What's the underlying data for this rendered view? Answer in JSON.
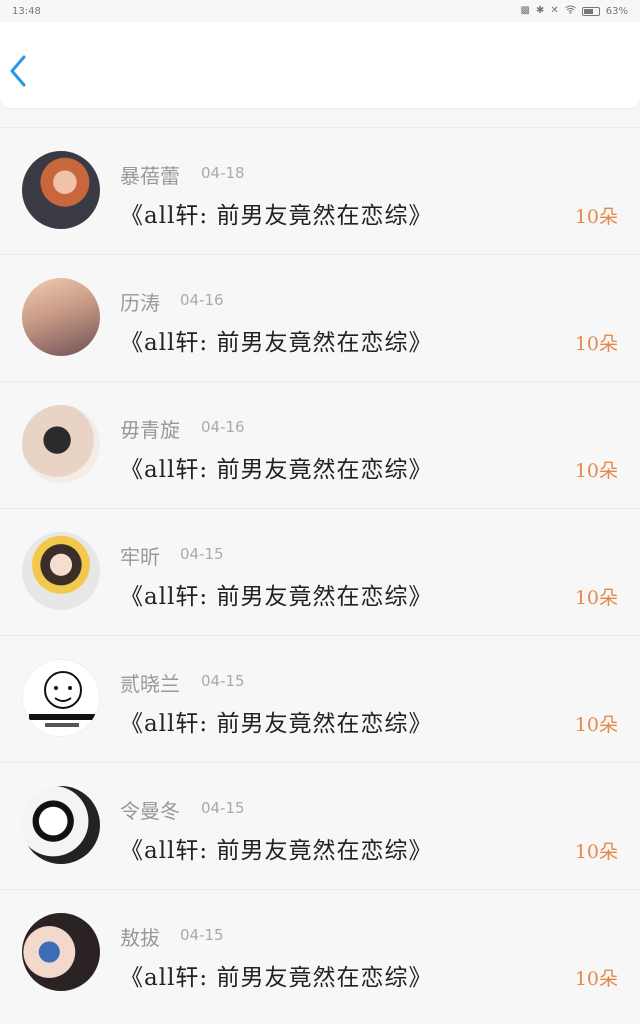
{
  "status_bar": {
    "time": "13:48",
    "battery": "63%",
    "battery_level": 0.63,
    "icons": [
      "nfc-icon",
      "bluetooth-icon",
      "mute-icon",
      "wifi-icon",
      "battery-icon"
    ]
  },
  "header": {
    "back_icon": "chevron-left-icon",
    "accent": "#2a97e6"
  },
  "list": [
    {
      "name": "暴蓓蕾",
      "date": "04-18",
      "title": "《all轩:  前男友竟然在恋综》",
      "amount": "10朵"
    },
    {
      "name": "历涛",
      "date": "04-16",
      "title": "《all轩:  前男友竟然在恋综》",
      "amount": "10朵"
    },
    {
      "name": "毋青旋",
      "date": "04-16",
      "title": "《all轩:  前男友竟然在恋综》",
      "amount": "10朵"
    },
    {
      "name": "牢昕",
      "date": "04-15",
      "title": "《all轩:  前男友竟然在恋综》",
      "amount": "10朵"
    },
    {
      "name": "贰晓兰",
      "date": "04-15",
      "title": "《all轩:  前男友竟然在恋综》",
      "amount": "10朵"
    },
    {
      "name": "令曼冬",
      "date": "04-15",
      "title": "《all轩:  前男友竟然在恋综》",
      "amount": "10朵"
    },
    {
      "name": "敖拔",
      "date": "04-15",
      "title": "《all轩:  前男友竟然在恋综》",
      "amount": "10朵"
    }
  ],
  "colors": {
    "amount": "#e6884a",
    "name": "#999999",
    "title": "#222222"
  }
}
